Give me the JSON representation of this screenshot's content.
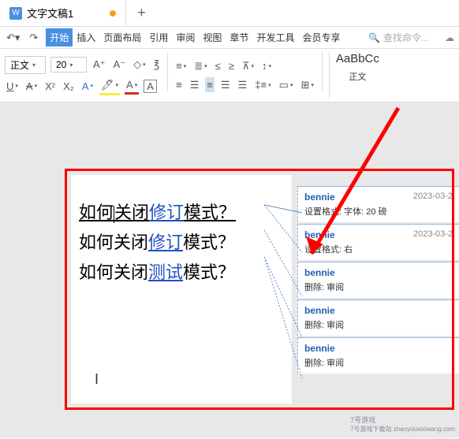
{
  "titlebar": {
    "doc_icon": "W",
    "tab_title": "文字文稿1"
  },
  "menubar": {
    "start": "开始",
    "insert": "插入",
    "layout": "页面布局",
    "reference": "引用",
    "review": "审阅",
    "view": "视图",
    "chapter": "章节",
    "dev": "开发工具",
    "member": "会员专享",
    "search_placeholder": "查找命令..."
  },
  "ribbon": {
    "style_name": "正文",
    "font_size": "20",
    "style_preview": "AaBbCc",
    "style_label": "正文"
  },
  "doc": {
    "line1_a": "如何",
    "line1_b": "关闭",
    "line1_c": "修订",
    "line1_d": "模式？",
    "line2_a": "如何关闭",
    "line2_b": "修订",
    "line2_c": "模式？",
    "line3_a": "如何关闭",
    "line3_b": "测试",
    "line3_c": "模式？"
  },
  "comments": [
    {
      "author": "bennie",
      "date": "2023-03-2",
      "text": "设置格式: 字体: 20 磅"
    },
    {
      "author": "bennie",
      "date": "2023-03-2",
      "text": "设置格式: 右"
    },
    {
      "author": "bennie",
      "date": "",
      "text": "删除: 审阅"
    },
    {
      "author": "bennie",
      "date": "",
      "text": "删除: 审阅"
    },
    {
      "author": "bennie",
      "date": "",
      "text": "删除: 审阅"
    }
  ],
  "watermark": {
    "name": "7号游戏",
    "url": "7号游戏下载站 zhaoyouxixiwang.com"
  }
}
